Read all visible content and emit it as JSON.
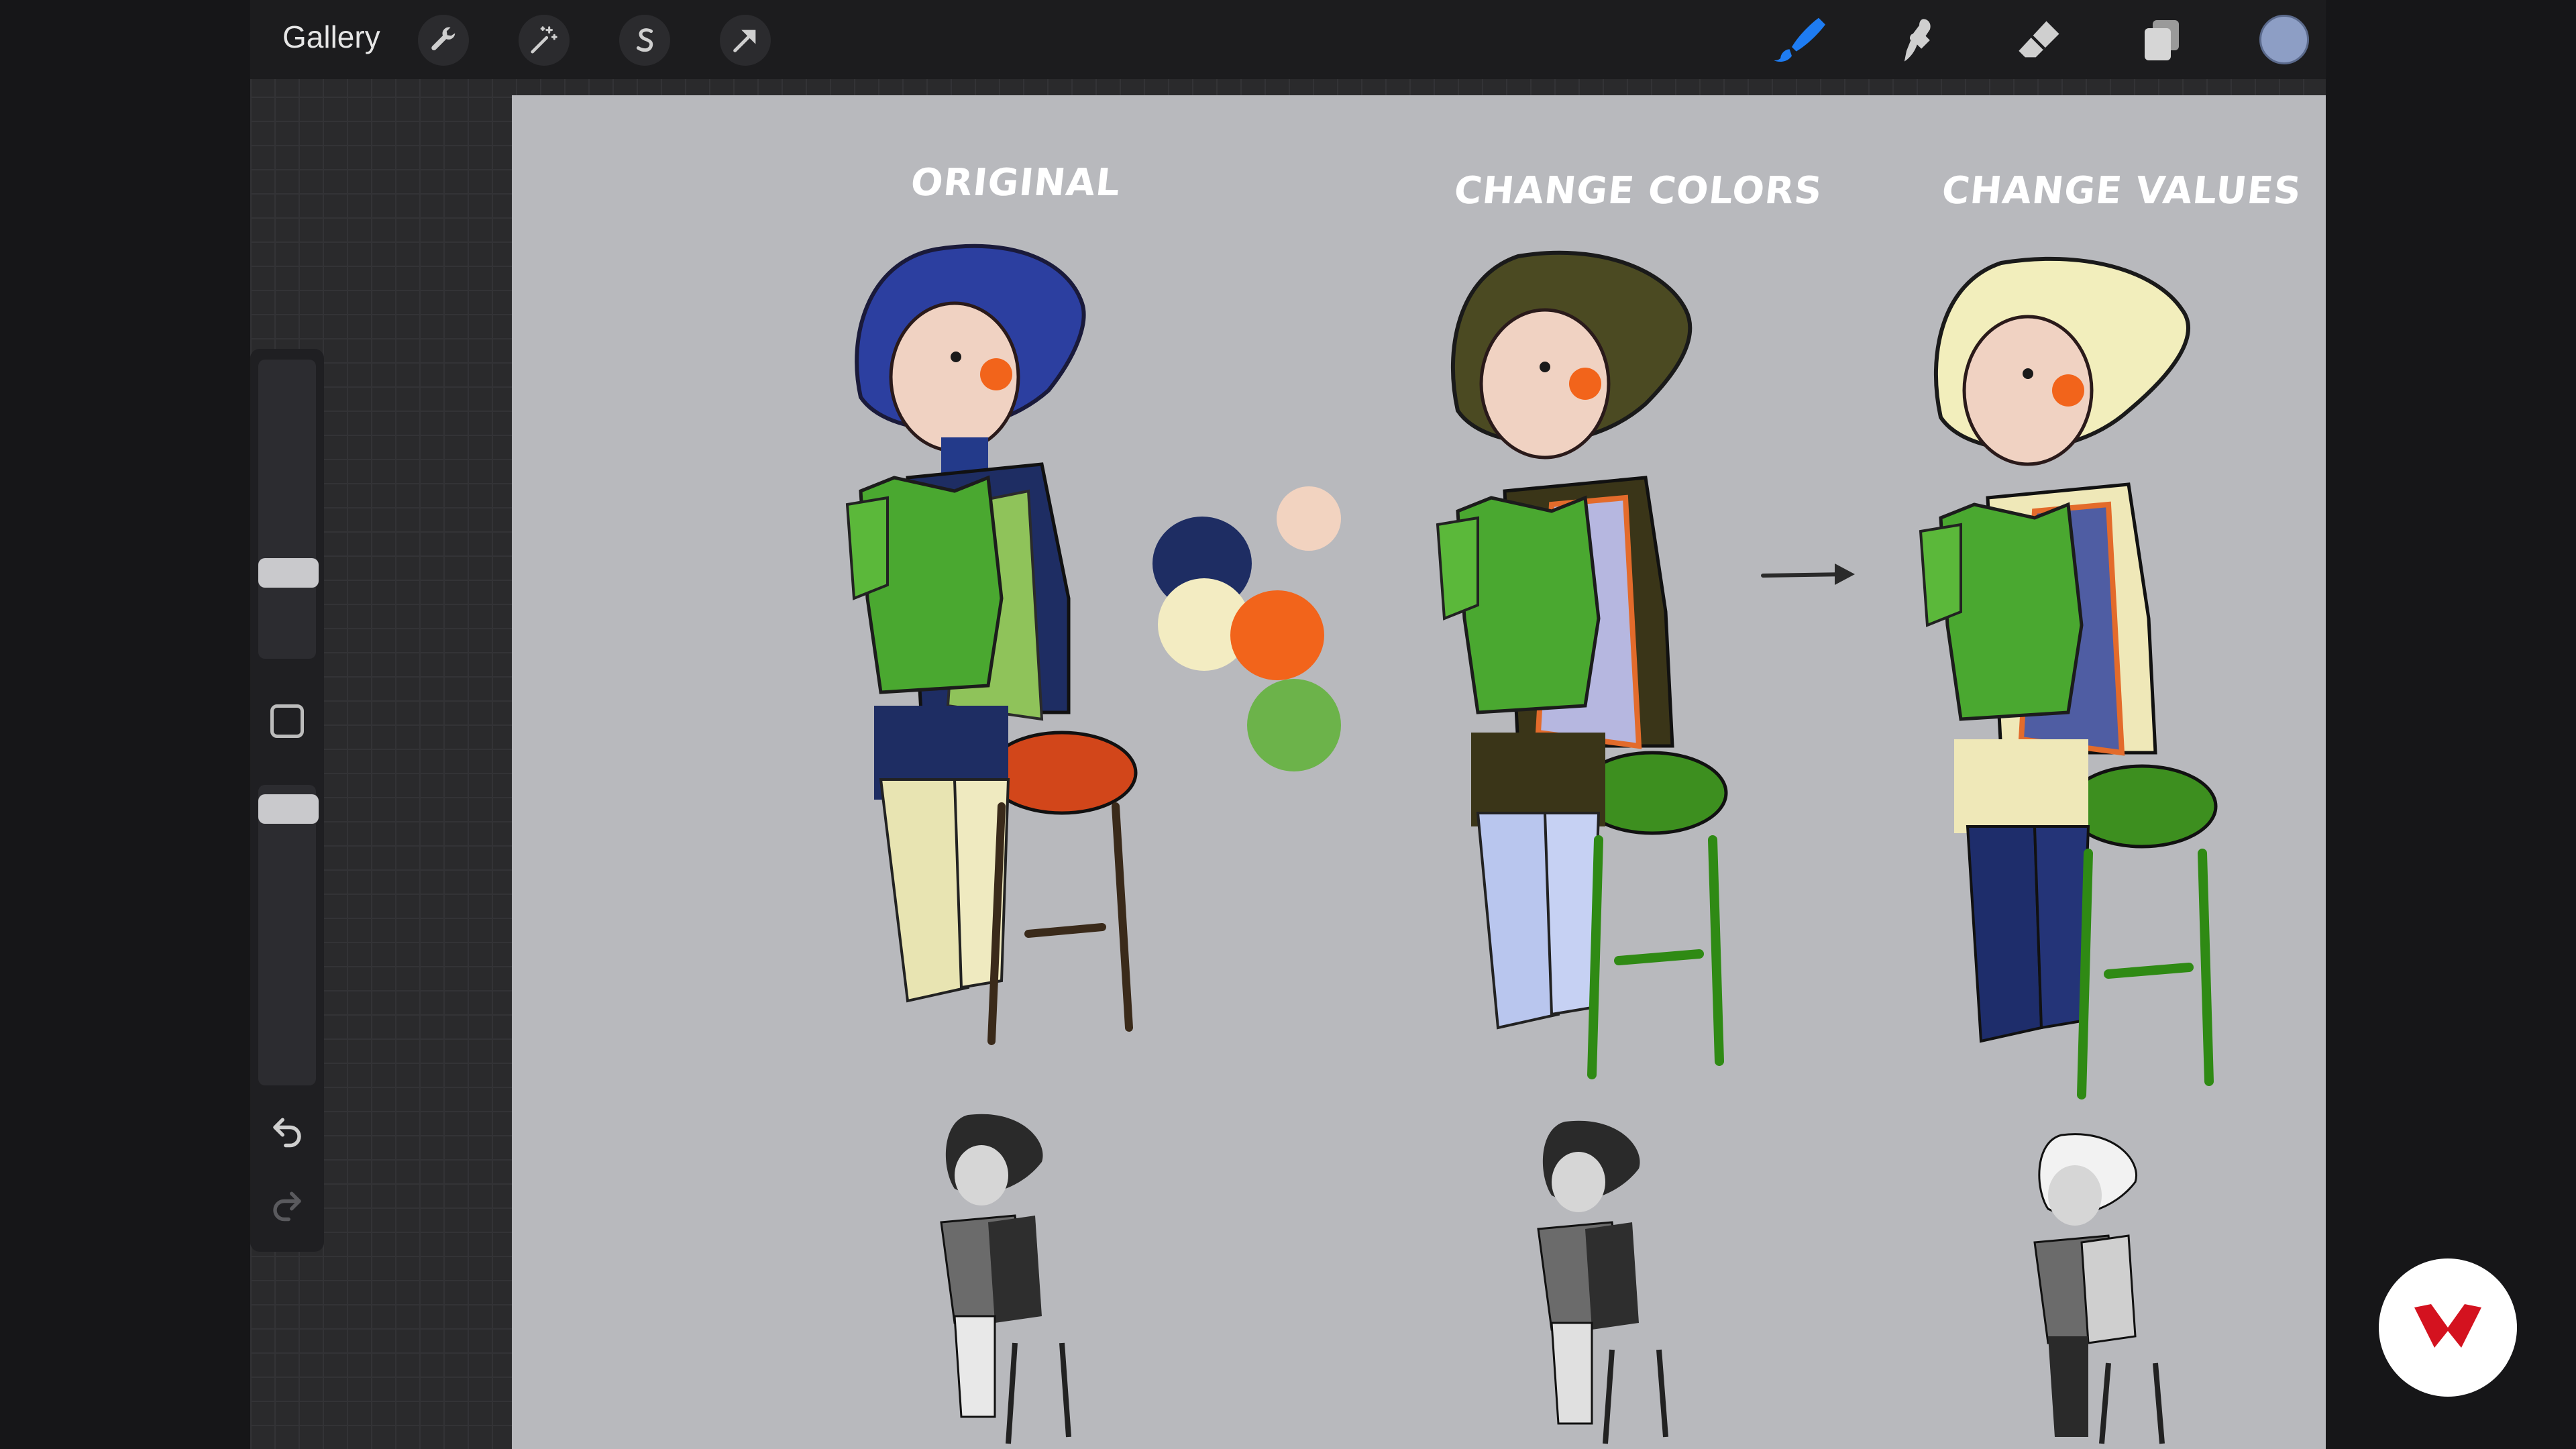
{
  "topbar": {
    "gallery_label": "Gallery",
    "left_tools": [
      "wrench-icon",
      "magic-wand-icon",
      "selection-s-icon",
      "transform-arrow-icon"
    ],
    "right_tools": [
      "brush-icon",
      "smudge-icon",
      "eraser-icon",
      "layers-icon",
      "color-swatch"
    ],
    "active_tool": "brush-icon",
    "accent_color": "#1e7cf2",
    "current_color": "#8d9ec5"
  },
  "canvas": {
    "labels": {
      "original": "ORIGINAL",
      "change_colors": "CHANGE COLORS",
      "change_values": "CHANGE VALUES"
    },
    "palette_colors": [
      "#f2d3c0",
      "#1e2d63",
      "#f3ecc2",
      "#f2641b",
      "#6cb34a"
    ],
    "background": "#b8b9bd"
  },
  "sidebar": {
    "brush_size_level": 0.62,
    "opacity_level": 1.0,
    "undo_icon": "undo-arrow-icon",
    "redo_icon": "redo-arrow-icon"
  },
  "badge": {
    "icon": "brand-logo-icon",
    "color": "#d4121f"
  }
}
